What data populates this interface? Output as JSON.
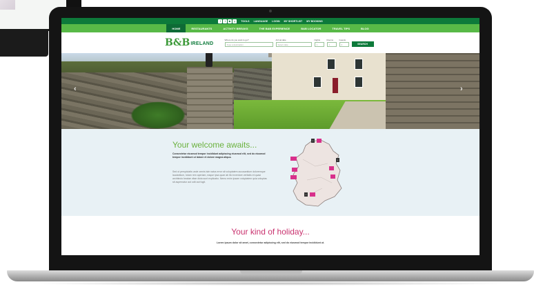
{
  "topbar": {
    "social_icons": [
      "facebook-icon",
      "twitter-icon",
      "youtube-icon",
      "pinterest-icon"
    ],
    "links": [
      "Tools",
      "Language",
      "Login",
      "My Shortlist",
      "My Booking"
    ]
  },
  "nav": {
    "items": [
      "Home",
      "Restaurants",
      "Activity Breaks",
      "The B&B Experience",
      "B&B Locator",
      "Travel Tips",
      "Blog"
    ]
  },
  "logo": {
    "mark": "B&B",
    "text": "IRELAND"
  },
  "search": {
    "where_label": "Where do you want to go?",
    "where_placeholder": "Type a destination",
    "arrival_label": "Arrival date",
    "arrival_placeholder": "Select date",
    "nights_label": "Nights",
    "nights_value": "1",
    "rooms_label": "Rooms",
    "rooms_value": "1",
    "guests_label": "Guests",
    "guests_value": "2",
    "button_label": "SEARCH"
  },
  "welcome": {
    "heading": "Your welcome awaits...",
    "intro_bold": "Consectetur eiusmod tempor incididunt adipiscing eiusmod elit, sed do eiusmod tempor incididunt ut labore et dolore magna aliqua.",
    "intro": "Sed ut perspiciatis unde omnis iste natus error sit voluptatem accusantium doloremque laudantium, totam rem aperiam, eaque ipsa quae ab illo inventore veritatis et quasi architecto beatae vitae dicta sunt explicabo. Nemo enim ipsam voluptatem quia voluptas sit aspernatur aut odit aut fugit."
  },
  "holiday": {
    "heading": "Your kind of holiday...",
    "text": "Lorem ipsum dolor sit amet, consectetur adipiscing elit, sed do eiusmod tempor incididunt ut."
  },
  "colors": {
    "dark_green": "#0d7a3a",
    "light_green": "#58b947",
    "welcome_green": "#6ab13d",
    "holiday_pink": "#c9326f",
    "pin_pink": "#d8308b"
  }
}
